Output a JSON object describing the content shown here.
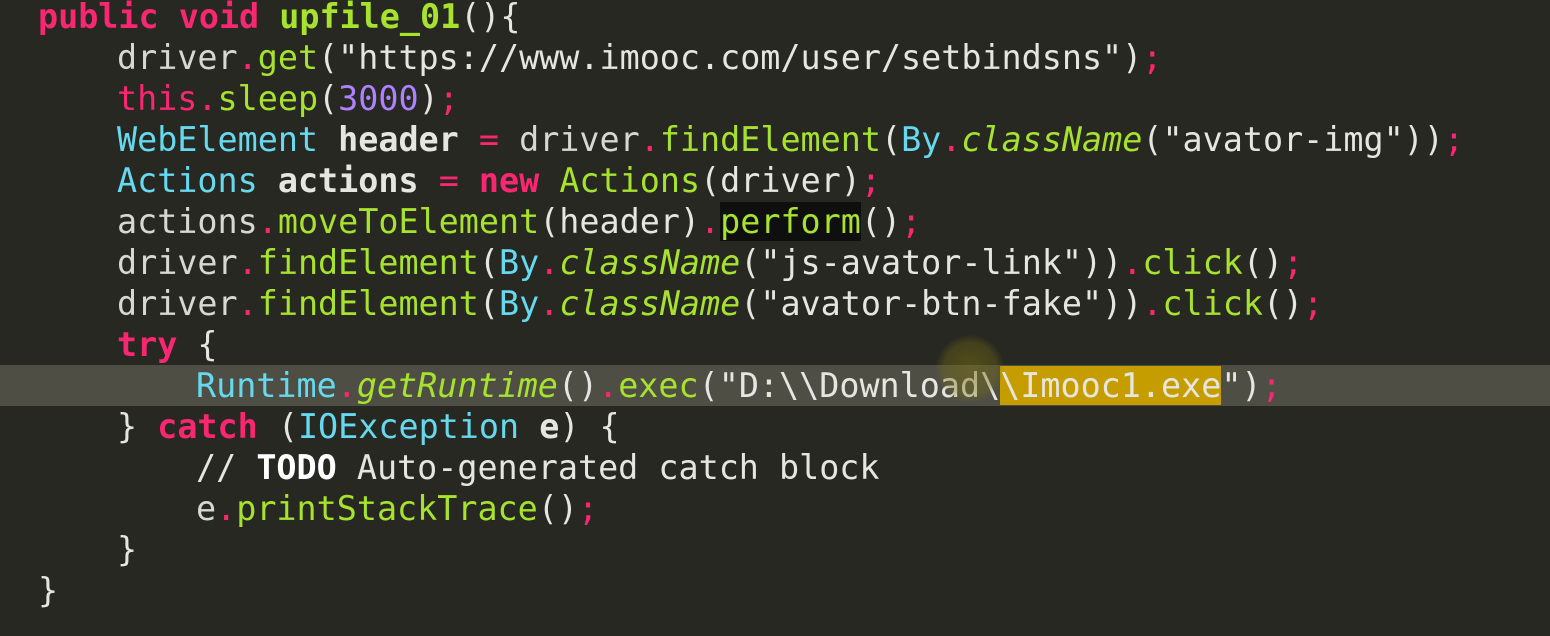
{
  "editor": {
    "colors": {
      "background": "#272822",
      "current_line": "#4e4e45",
      "keyword": "#f92672",
      "text": "#d8d8d2",
      "method": "#a6e22e",
      "type": "#66d9ef",
      "string": "#e6db74",
      "number": "#ae81ff",
      "comment": "#75715e",
      "highlight_bg": "#c69d00",
      "match_bg": "#0f0f0f"
    },
    "lines": [
      {
        "indent": 0,
        "tokens": [
          {
            "t": "public",
            "c": "#f92672",
            "b": true
          },
          {
            "t": " "
          },
          {
            "t": "void",
            "c": "#f92672",
            "b": true
          },
          {
            "t": " "
          },
          {
            "t": "upfile_01",
            "c": "#a6e22e",
            "b": true
          },
          {
            "t": "(){",
            "c": "#e6e6e0"
          }
        ]
      },
      {
        "indent": 1,
        "tokens": [
          {
            "t": "driver",
            "c": "#d8d8d2"
          },
          {
            "t": ".",
            "c": "#f92672"
          },
          {
            "t": "get",
            "c": "#a6e22e"
          },
          {
            "t": "(\"https://www.imooc.com/user/setbindsns\")",
            "c": "#e6e6e0"
          },
          {
            "t": ";",
            "c": "#f92672"
          }
        ]
      },
      {
        "indent": 1,
        "tokens": [
          {
            "t": "this",
            "c": "#f92672"
          },
          {
            "t": ".",
            "c": "#f92672"
          },
          {
            "t": "sleep",
            "c": "#a6e22e"
          },
          {
            "t": "(",
            "c": "#e6e6e0"
          },
          {
            "t": "3000",
            "c": "#ae81ff"
          },
          {
            "t": ")",
            "c": "#e6e6e0"
          },
          {
            "t": ";",
            "c": "#f92672"
          }
        ]
      },
      {
        "indent": 1,
        "tokens": [
          {
            "t": "WebElement",
            "c": "#66d9ef"
          },
          {
            "t": " "
          },
          {
            "t": "header",
            "c": "#e6e6e0",
            "b": true
          },
          {
            "t": " "
          },
          {
            "t": "=",
            "c": "#f92672"
          },
          {
            "t": " "
          },
          {
            "t": "driver",
            "c": "#d8d8d2"
          },
          {
            "t": ".",
            "c": "#f92672"
          },
          {
            "t": "findElement",
            "c": "#a6e22e"
          },
          {
            "t": "(",
            "c": "#e6e6e0"
          },
          {
            "t": "By",
            "c": "#66d9ef"
          },
          {
            "t": ".",
            "c": "#f92672"
          },
          {
            "t": "className",
            "c": "#a6e22e",
            "i": true
          },
          {
            "t": "(\"avator-img\"))",
            "c": "#e6e6e0"
          },
          {
            "t": ";",
            "c": "#f92672"
          }
        ]
      },
      {
        "indent": 1,
        "tokens": [
          {
            "t": "Actions",
            "c": "#66d9ef"
          },
          {
            "t": " "
          },
          {
            "t": "actions",
            "c": "#e6e6e0",
            "b": true
          },
          {
            "t": " "
          },
          {
            "t": "=",
            "c": "#f92672"
          },
          {
            "t": " "
          },
          {
            "t": "new",
            "c": "#f92672",
            "b": true
          },
          {
            "t": " "
          },
          {
            "t": "Actions",
            "c": "#a6e22e"
          },
          {
            "t": "(driver)",
            "c": "#e6e6e0"
          },
          {
            "t": ";",
            "c": "#f92672"
          }
        ]
      },
      {
        "indent": 1,
        "tokens": [
          {
            "t": "actions",
            "c": "#d8d8d2"
          },
          {
            "t": ".",
            "c": "#f92672"
          },
          {
            "t": "moveToElement",
            "c": "#a6e22e"
          },
          {
            "t": "(header)",
            "c": "#e6e6e0"
          },
          {
            "t": ".",
            "c": "#f92672"
          },
          {
            "t": "perform",
            "c": "#a6e22e",
            "bg": "#0f0f0f"
          },
          {
            "t": "()",
            "c": "#e6e6e0"
          },
          {
            "t": ";",
            "c": "#f92672"
          }
        ]
      },
      {
        "indent": 1,
        "tokens": [
          {
            "t": "driver",
            "c": "#d8d8d2"
          },
          {
            "t": ".",
            "c": "#f92672"
          },
          {
            "t": "findElement",
            "c": "#a6e22e"
          },
          {
            "t": "(",
            "c": "#e6e6e0"
          },
          {
            "t": "By",
            "c": "#66d9ef"
          },
          {
            "t": ".",
            "c": "#f92672"
          },
          {
            "t": "className",
            "c": "#a6e22e",
            "i": true
          },
          {
            "t": "(\"js-avator-link\"))",
            "c": "#e6e6e0"
          },
          {
            "t": ".",
            "c": "#f92672"
          },
          {
            "t": "click",
            "c": "#a6e22e"
          },
          {
            "t": "()",
            "c": "#e6e6e0"
          },
          {
            "t": ";",
            "c": "#f92672"
          }
        ]
      },
      {
        "indent": 1,
        "tokens": [
          {
            "t": "driver",
            "c": "#d8d8d2"
          },
          {
            "t": ".",
            "c": "#f92672"
          },
          {
            "t": "findElement",
            "c": "#a6e22e"
          },
          {
            "t": "(",
            "c": "#e6e6e0"
          },
          {
            "t": "By",
            "c": "#66d9ef"
          },
          {
            "t": ".",
            "c": "#f92672"
          },
          {
            "t": "className",
            "c": "#a6e22e",
            "i": true
          },
          {
            "t": "(\"avator-btn-fake\"))",
            "c": "#e6e6e0"
          },
          {
            "t": ".",
            "c": "#f92672"
          },
          {
            "t": "click",
            "c": "#a6e22e"
          },
          {
            "t": "()",
            "c": "#e6e6e0"
          },
          {
            "t": ";",
            "c": "#f92672"
          }
        ]
      },
      {
        "indent": 1,
        "tokens": [
          {
            "t": "try",
            "c": "#f92672",
            "b": true
          },
          {
            "t": " {",
            "c": "#e6e6e0"
          }
        ]
      },
      {
        "indent": 2,
        "current": true,
        "tokens": [
          {
            "t": "Runtime",
            "c": "#66d9ef"
          },
          {
            "t": ".",
            "c": "#f92672"
          },
          {
            "t": "getRuntime",
            "c": "#a6e22e",
            "i": true
          },
          {
            "t": "()",
            "c": "#e6e6e0"
          },
          {
            "t": ".",
            "c": "#f92672"
          },
          {
            "t": "exec",
            "c": "#a6e22e"
          },
          {
            "t": "(\"D:\\\\Download\\",
            "c": "#e6e6e0"
          },
          {
            "t": "\\Imooc1.exe",
            "c": "#e6e6e0",
            "bg": "#c69d00"
          },
          {
            "t": "\")",
            "c": "#e6e6e0"
          },
          {
            "t": ";",
            "c": "#f92672"
          }
        ]
      },
      {
        "indent": 1,
        "tokens": [
          {
            "t": "} ",
            "c": "#e6e6e0"
          },
          {
            "t": "catch",
            "c": "#f92672",
            "b": true
          },
          {
            "t": " (",
            "c": "#e6e6e0"
          },
          {
            "t": "IOException",
            "c": "#66d9ef"
          },
          {
            "t": " "
          },
          {
            "t": "e",
            "c": "#e6e6e0",
            "b": true
          },
          {
            "t": ") {",
            "c": "#e6e6e0"
          }
        ]
      },
      {
        "indent": 2,
        "tokens": [
          {
            "t": "// ",
            "c": "#e6e6e0"
          },
          {
            "t": "TODO",
            "c": "#ffffff",
            "b": true
          },
          {
            "t": " Auto-generated catch block",
            "c": "#e6e6e0"
          }
        ]
      },
      {
        "indent": 2,
        "tokens": [
          {
            "t": "e",
            "c": "#d8d8d2"
          },
          {
            "t": ".",
            "c": "#f92672"
          },
          {
            "t": "printStackTrace",
            "c": "#a6e22e"
          },
          {
            "t": "()",
            "c": "#e6e6e0"
          },
          {
            "t": ";",
            "c": "#f92672"
          }
        ]
      },
      {
        "indent": 1,
        "tokens": [
          {
            "t": "}",
            "c": "#e6e6e0"
          }
        ]
      },
      {
        "indent": 0,
        "tokens": [
          {
            "t": "}",
            "c": "#e6e6e0"
          }
        ]
      }
    ]
  }
}
